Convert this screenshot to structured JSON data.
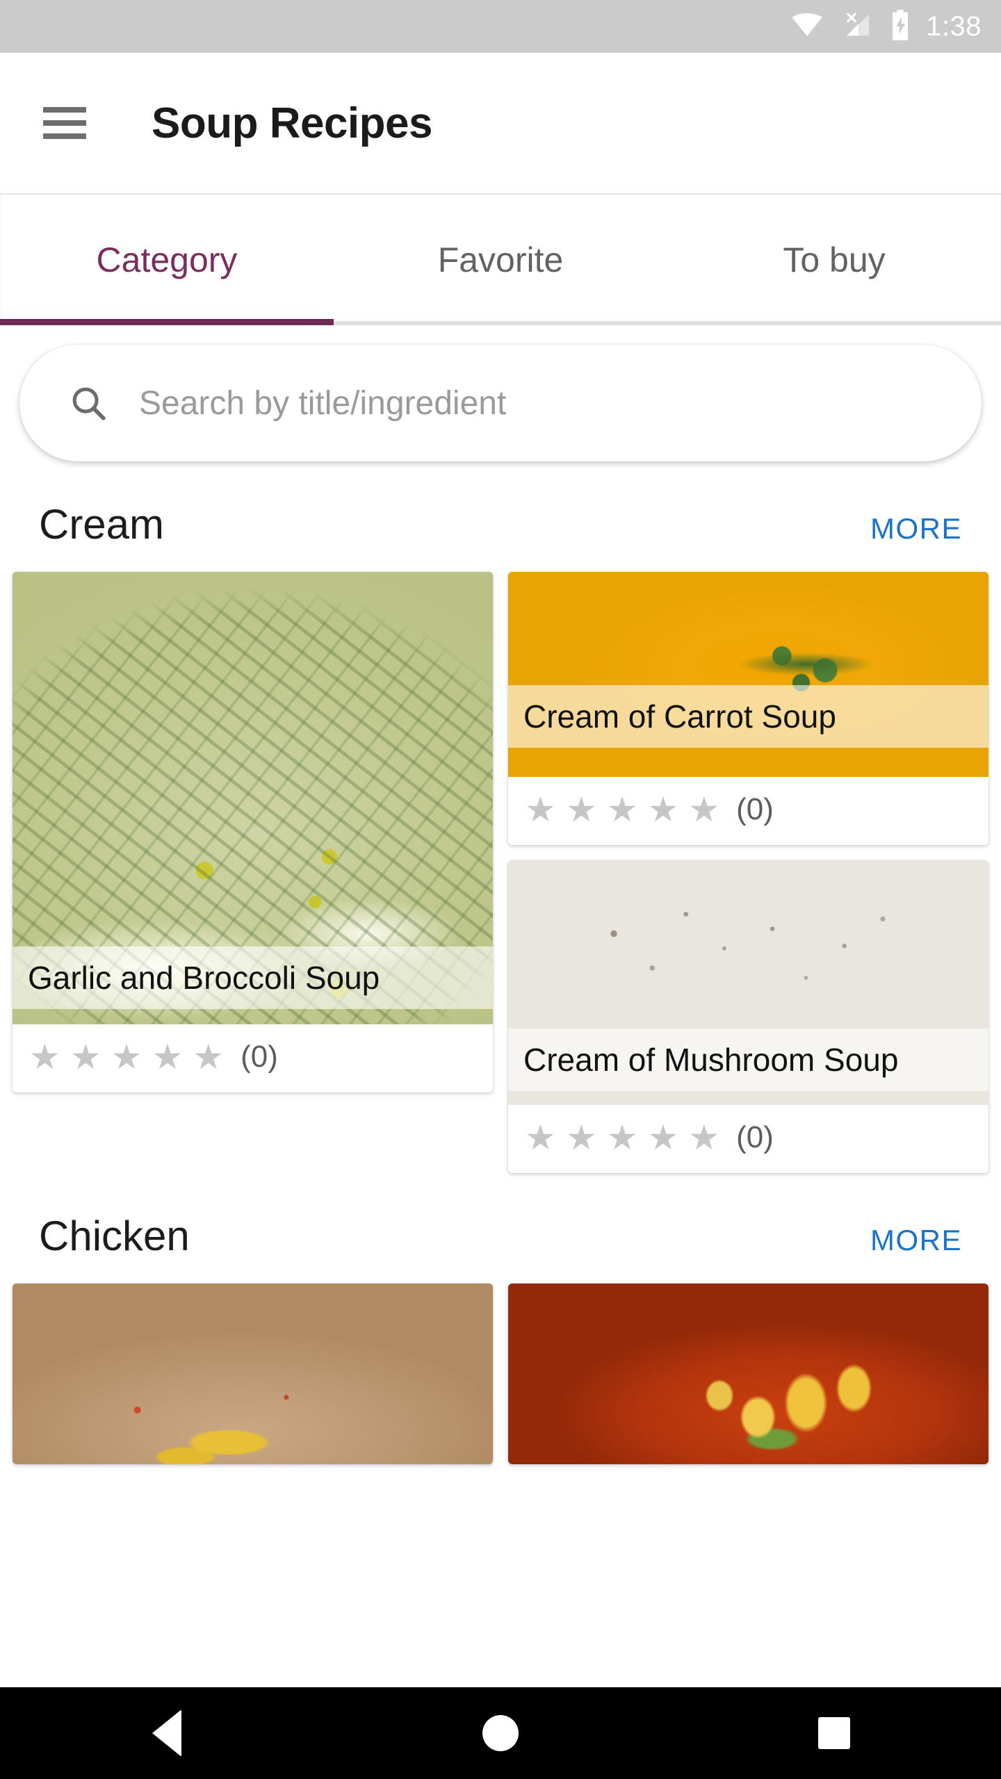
{
  "status_bar": {
    "time": "1:38",
    "icons": [
      "wifi-icon",
      "cellular-no-sim-icon",
      "battery-charging-icon"
    ]
  },
  "app_bar": {
    "menu_icon": "hamburger-menu-icon",
    "title": "Soup Recipes"
  },
  "tabs": {
    "active_index": 0,
    "items": [
      {
        "label": "Category"
      },
      {
        "label": "Favorite"
      },
      {
        "label": "To buy"
      }
    ]
  },
  "search": {
    "icon": "search-icon",
    "value": "",
    "placeholder": "Search by title/ingredient"
  },
  "colors": {
    "accent_purple": "#7B2D5E",
    "tab_indicator": "#6E2A53",
    "link_blue": "#1A73C8",
    "star_gray": "#C6C6C6",
    "status_bar_bg": "#CBCBCB",
    "nav_bar_bg": "#000000"
  },
  "sections": [
    {
      "title": "Cream",
      "more_label": "MORE",
      "featured": {
        "title": "Garlic and Broccoli Soup",
        "stars_total": 5,
        "stars_filled": 0,
        "rating_count": "(0)",
        "photo": "garlic-broccoli-soup-photo"
      },
      "cards": [
        {
          "title": "Cream of Carrot Soup",
          "stars_total": 5,
          "stars_filled": 0,
          "rating_count": "(0)",
          "photo": "cream-of-carrot-soup-photo"
        },
        {
          "title": "Cream of Mushroom Soup",
          "stars_total": 5,
          "stars_filled": 0,
          "rating_count": "(0)",
          "photo": "cream-of-mushroom-soup-photo"
        }
      ]
    },
    {
      "title": "Chicken",
      "more_label": "MORE",
      "featured": {
        "photo": "chicken-corn-soup-photo"
      },
      "cards": [
        {
          "photo": "chicken-noodle-soup-photo"
        }
      ]
    }
  ],
  "nav_bar": {
    "back_label": "Back",
    "home_label": "Home",
    "recents_label": "Recents"
  }
}
